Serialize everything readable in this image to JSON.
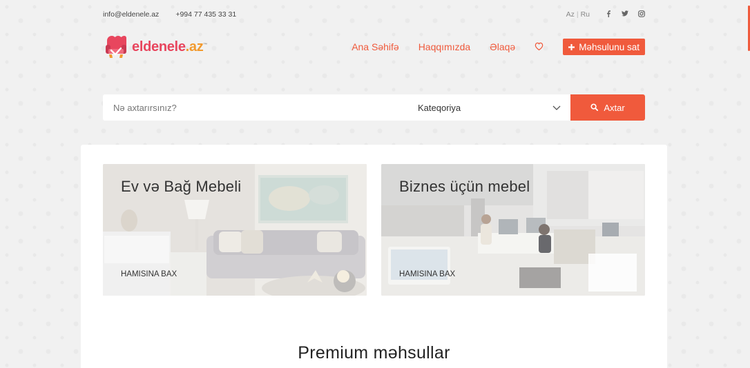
{
  "topbar": {
    "email": "info@eldenele.az",
    "phone": "+994 77 435 33 31",
    "lang_az": "Az",
    "lang_sep": "|",
    "lang_ru": "Ru"
  },
  "logo": {
    "name": "eldenele",
    "tld": ".az",
    "mark": "™"
  },
  "nav": {
    "home": "Ana Səhifə",
    "about": "Haqqımızda",
    "contact": "Əlaqə",
    "sell_label": "Məhsulunu sat"
  },
  "search": {
    "placeholder": "Nə axtarırsınız?",
    "category_value": "Kateqoriya",
    "button_label": "Axtar"
  },
  "cards": [
    {
      "title": "Ev və Bağ Mebeli",
      "link": "HAMISINA BAX"
    },
    {
      "title": "Biznes üçün mebel",
      "link": "HAMISINA BAX"
    }
  ],
  "section": {
    "premium_title": "Premium məhsullar"
  },
  "colors": {
    "accent": "#f05a3c",
    "logo_pink": "#e8465e",
    "logo_orange": "#f29a2e"
  },
  "icons": [
    "facebook-icon",
    "twitter-icon",
    "instagram-icon",
    "heart-icon",
    "plus-icon",
    "search-icon",
    "chevron-down-icon"
  ]
}
